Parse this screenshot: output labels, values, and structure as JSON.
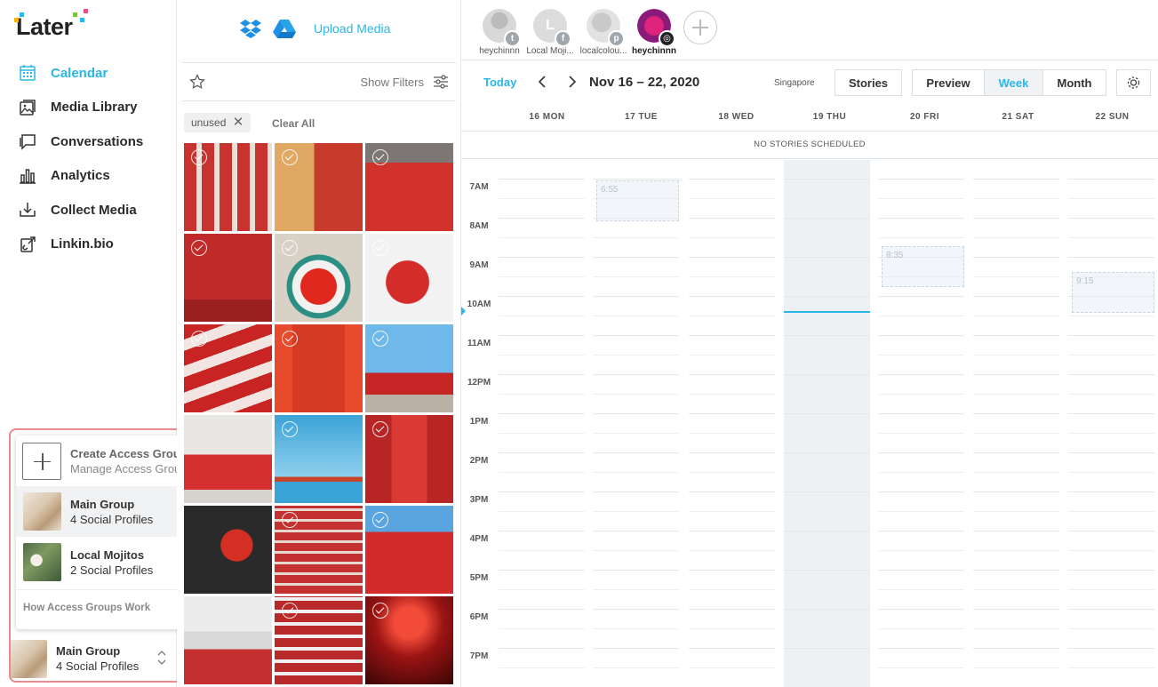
{
  "app": {
    "logo_text": "Later"
  },
  "sidebar": {
    "items": [
      {
        "label": "Calendar",
        "icon": "calendar-icon",
        "active": true
      },
      {
        "label": "Media Library",
        "icon": "media-library-icon"
      },
      {
        "label": "Conversations",
        "icon": "conversations-icon"
      },
      {
        "label": "Analytics",
        "icon": "analytics-icon"
      },
      {
        "label": "Collect Media",
        "icon": "collect-media-icon"
      },
      {
        "label": "Linkin.bio",
        "icon": "linkin-bio-icon"
      }
    ]
  },
  "access_groups": {
    "create_label": "Create Access Group",
    "manage_label": "Manage Access Groups",
    "groups": [
      {
        "name": "Main Group",
        "profiles": "4 Social Profiles",
        "selected": true
      },
      {
        "name": "Local Mojitos",
        "profiles": "2 Social Profiles",
        "selected": false
      }
    ],
    "how_label": "How Access Groups Work",
    "current": {
      "name": "Main Group",
      "profiles": "4 Social Profiles"
    }
  },
  "media": {
    "upload_label": "Upload Media",
    "show_filters_label": "Show Filters",
    "filter_chip": "unused",
    "clear_all_label": "Clear All"
  },
  "profiles": [
    {
      "name": "heychinnn",
      "network": "twitter",
      "active": false
    },
    {
      "name": "Local Moji...",
      "network": "facebook",
      "active": false
    },
    {
      "name": "localcolou...",
      "network": "pinterest",
      "active": false
    },
    {
      "name": "heychinnn",
      "network": "instagram",
      "active": true
    }
  ],
  "calendar": {
    "today_label": "Today",
    "date_range": "Nov 16 – 22, 2020",
    "timezone": "Singapore",
    "stories_button": "Stories",
    "views": [
      "Preview",
      "Week",
      "Month"
    ],
    "active_view": "Week",
    "days": [
      "16 MON",
      "17 TUE",
      "18 WED",
      "19 THU",
      "20 FRI",
      "21 SAT",
      "22 SUN"
    ],
    "no_stories_label": "NO STORIES SCHEDULED",
    "hours": [
      "7AM",
      "8AM",
      "9AM",
      "10AM",
      "11AM",
      "12PM",
      "1PM",
      "2PM",
      "3PM",
      "4PM",
      "5PM",
      "6PM",
      "7PM"
    ],
    "slots": [
      {
        "day_index": 1,
        "time": "6:55"
      },
      {
        "day_index": 4,
        "time": "8:35"
      },
      {
        "day_index": 6,
        "time": "9:15"
      }
    ]
  },
  "colors": {
    "accent": "#29b6e8",
    "highlight_border": "#e88a8f"
  }
}
